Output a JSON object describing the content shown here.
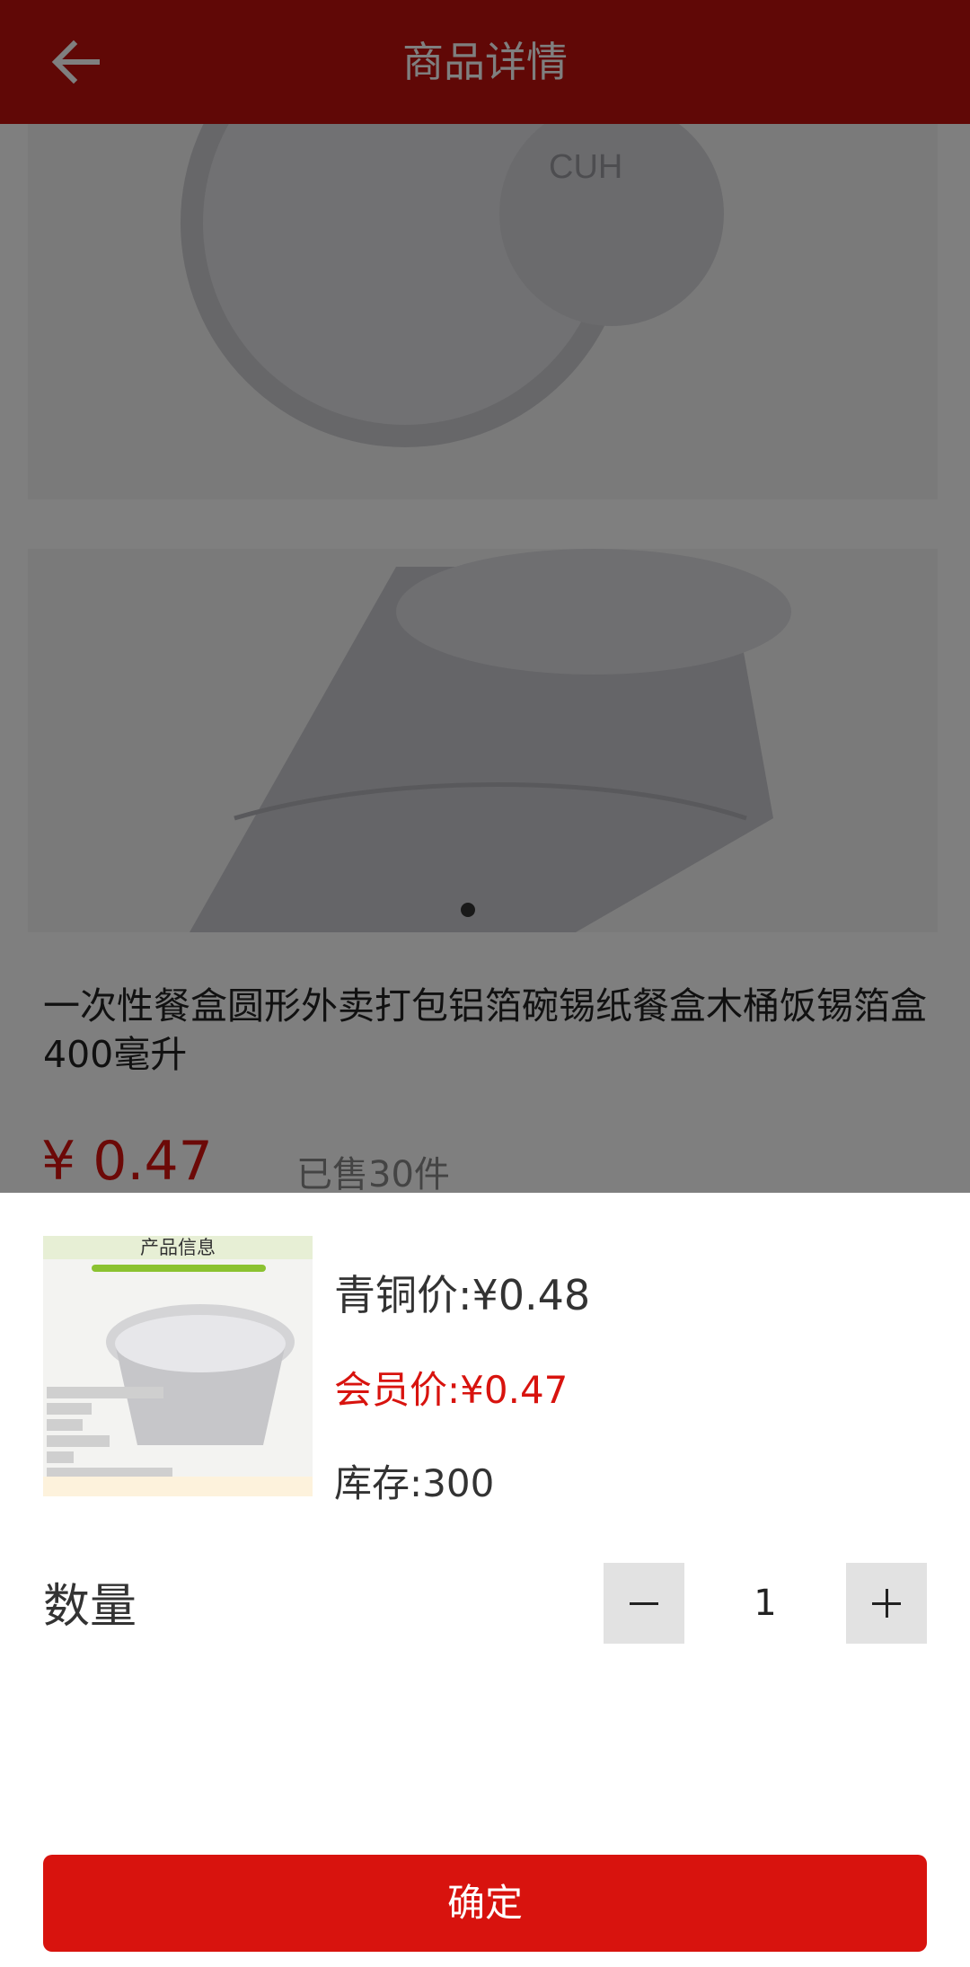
{
  "header": {
    "title": "商品详情",
    "back_icon": "arrow-left-icon"
  },
  "product": {
    "title": "一次性餐盒圆形外卖打包铝箔碗锡纸餐盒木桶饭锡箔盒400毫升",
    "price": "¥ 0.47",
    "sold": "已售30件",
    "images": [
      "aluminum-bowl-top",
      "aluminum-bowl-side"
    ]
  },
  "sku_sheet": {
    "thumb_caption": "产品信息",
    "bronze_price": "青铜价:¥0.48",
    "member_price": "会员价:¥0.47",
    "stock": "库存:300",
    "quantity_label": "数量",
    "quantity": "1",
    "confirm_label": "确定"
  },
  "colors": {
    "brand_red": "#d8130e",
    "header_red": "#c1110d"
  }
}
